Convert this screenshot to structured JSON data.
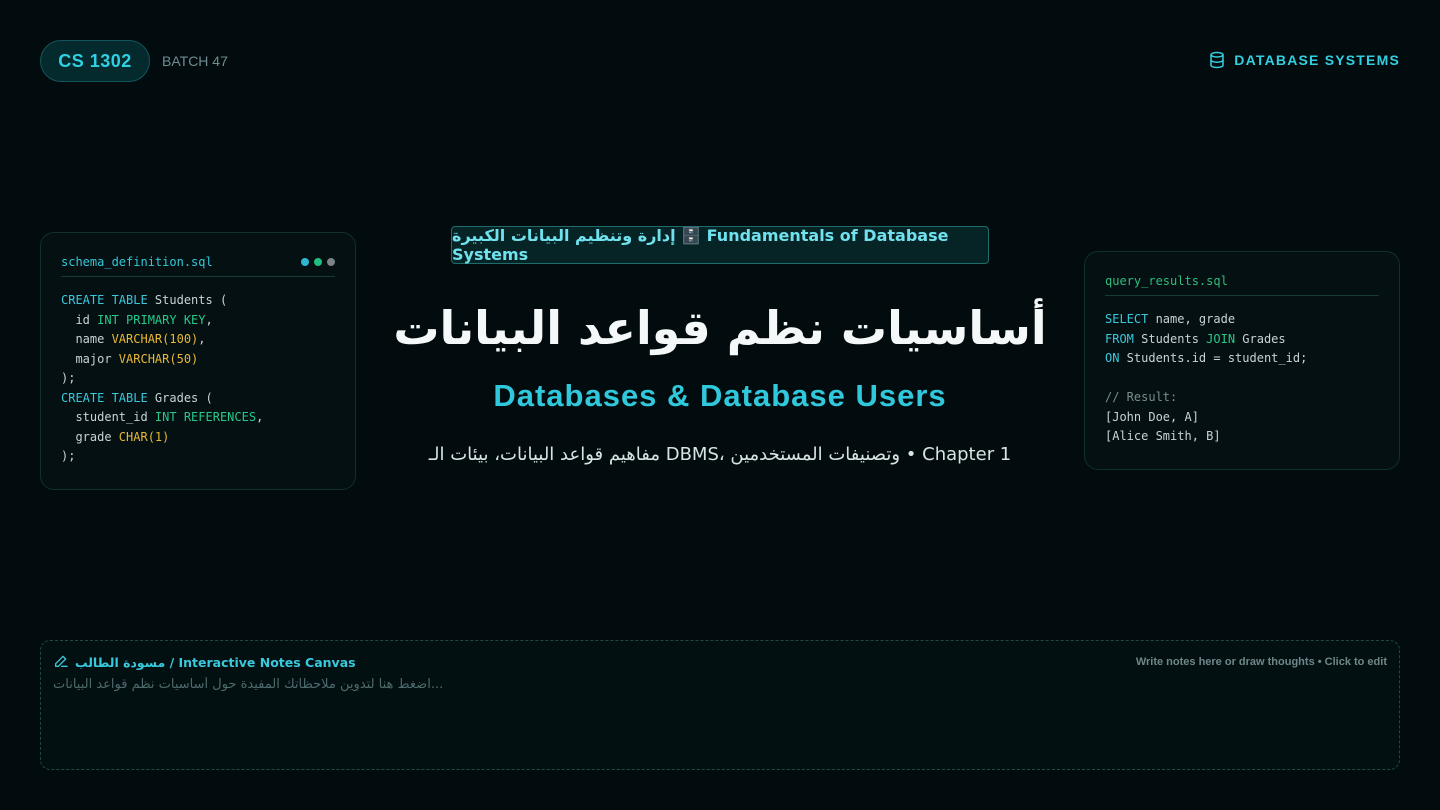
{
  "header": {
    "course_code": "CS 1302",
    "batch": "BATCH 47",
    "brand": "DATABASE SYSTEMS",
    "brand_icon": "database-icon"
  },
  "left_card": {
    "filename": "schema_definition.sql",
    "dots": [
      "#2fb6d0",
      "#1fbf83",
      "#7a8486"
    ],
    "lines": [
      [
        {
          "t": "CREATE TABLE",
          "c": "kw"
        },
        {
          "t": " Students (",
          "c": "tx"
        }
      ],
      [
        {
          "t": "  id ",
          "c": "tx"
        },
        {
          "t": "INT PRIMARY KEY",
          "c": "ty"
        },
        {
          "t": ",",
          "c": "tx"
        }
      ],
      [
        {
          "t": "  name ",
          "c": "tx"
        },
        {
          "t": "VARCHAR(100)",
          "c": "ty2"
        },
        {
          "t": ",",
          "c": "tx"
        }
      ],
      [
        {
          "t": "  major ",
          "c": "tx"
        },
        {
          "t": "VARCHAR(50)",
          "c": "ty2"
        }
      ],
      [
        {
          "t": ");",
          "c": "tx"
        }
      ],
      [
        {
          "t": "CREATE TABLE",
          "c": "kw"
        },
        {
          "t": " Grades (",
          "c": "tx"
        }
      ],
      [
        {
          "t": "  student_id ",
          "c": "tx"
        },
        {
          "t": "INT REFERENCES",
          "c": "ty"
        },
        {
          "t": ",",
          "c": "tx"
        }
      ],
      [
        {
          "t": "  grade ",
          "c": "tx"
        },
        {
          "t": "CHAR(1)",
          "c": "ty2"
        }
      ],
      [
        {
          "t": ");",
          "c": "tx"
        }
      ]
    ]
  },
  "right_card": {
    "filename": "query_results.sql",
    "lines": [
      [
        {
          "t": "SELECT",
          "c": "kw"
        },
        {
          "t": " name, grade",
          "c": "tx"
        }
      ],
      [
        {
          "t": "FROM",
          "c": "kw"
        },
        {
          "t": " Students ",
          "c": "tx"
        },
        {
          "t": "JOIN",
          "c": "ty"
        },
        {
          "t": " Grades",
          "c": "tx"
        }
      ],
      [
        {
          "t": "ON",
          "c": "kw"
        },
        {
          "t": " Students.id = student_id;",
          "c": "tx"
        }
      ],
      [
        {
          "t": "",
          "c": "tx"
        }
      ],
      [
        {
          "t": "// Result:",
          "c": "cm"
        }
      ],
      [
        {
          "t": "[John Doe, A]",
          "c": "tx"
        }
      ],
      [
        {
          "t": "[Alice Smith, B]",
          "c": "tx"
        }
      ]
    ]
  },
  "center": {
    "tag": "إدارة وتنظيم البيانات الكبيرة 🗄️ Fundamentals of Database Systems",
    "title": "أساسيات نظم قواعد البيانات",
    "subtitle": "Databases & Database Users",
    "description": "مفاهيم قواعد البيانات، بيئات الـ DBMS، وتصنيفات المستخدمين • Chapter 1"
  },
  "notes": {
    "title": "مسودة الطالب / Interactive Notes Canvas",
    "hint": "Write notes here or draw thoughts • Click to edit",
    "placeholder": "اضغط هنا لتدوين ملاحظاتك المفيدة حول أساسيات نظم قواعد البيانات...",
    "value": "",
    "icon": "pencil-icon"
  }
}
